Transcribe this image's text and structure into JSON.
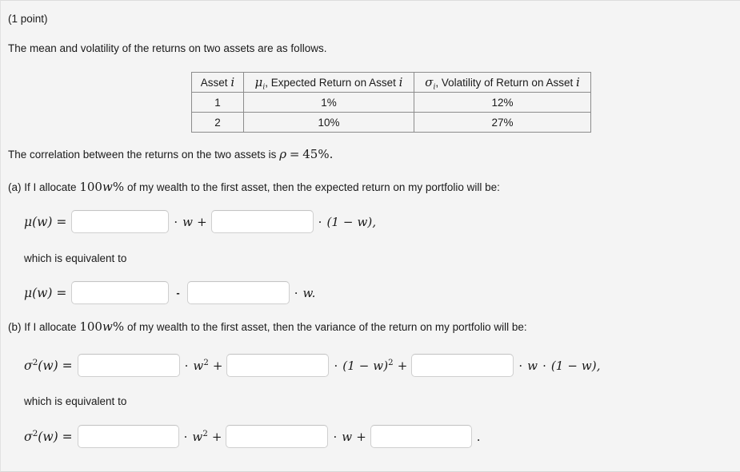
{
  "header": {
    "points": "(1 point)"
  },
  "intro": {
    "text": "The mean and volatility of the returns on two assets are as follows."
  },
  "table": {
    "headers": {
      "asset": "Asset i",
      "asset_plain": "Asset",
      "asset_sym": "i",
      "mu_sym": "μ",
      "mu_sub": "i",
      "mu_rest": ", Expected Return on Asset",
      "mu_trail": "i",
      "sigma_sym": "σ",
      "sigma_sub": "i",
      "sigma_rest": ", Volatility of Return on Asset",
      "sigma_trail": "i"
    },
    "rows": [
      {
        "asset": "1",
        "expected_return": "1%",
        "volatility": "12%"
      },
      {
        "asset": "2",
        "expected_return": "10%",
        "volatility": "27%"
      }
    ]
  },
  "correlation": {
    "prefix": "The correlation between the returns on the two assets is",
    "rho": "ρ",
    "equals": "=",
    "value": "45%",
    "period": "."
  },
  "part_a": {
    "label": "(a) If I allocate",
    "amount": "100",
    "amount_var": "w",
    "amount_pct": "%",
    "rest": "of my wealth to the first asset, then the expected return on my portfolio will be:",
    "equiv_text": "which is equivalent to",
    "formula1": {
      "lhs": "μ(w) =",
      "dot1": "·",
      "term1": "w",
      "plus": "+",
      "dot2": "·",
      "term2": "(1 − w),",
      "input1_value": "",
      "input2_value": ""
    },
    "formula2": {
      "lhs": "μ(w) =",
      "minus": "-",
      "dot1": "·",
      "term1": "w.",
      "input1_value": "",
      "input2_value": ""
    }
  },
  "part_b": {
    "label": "(b) If I allocate",
    "amount": "100",
    "amount_var": "w",
    "amount_pct": "%",
    "rest": "of my wealth to the first asset, then the variance of the return on my portfolio will be:",
    "equiv_text": "which is equivalent to",
    "formula1": {
      "lhs_sigma": "σ",
      "lhs_exp": "2",
      "lhs_arg": "(w) =",
      "dot1": "·",
      "term1_var": "w",
      "term1_exp": "2",
      "plus1": "+",
      "dot2": "·",
      "term2": "(1 − w)",
      "term2_exp": "2",
      "plus2": "+",
      "dot3": "·",
      "term3": "w",
      "dot4": "·",
      "term4": "(1 − w),",
      "input1_value": "",
      "input2_value": "",
      "input3_value": ""
    },
    "formula2": {
      "lhs_sigma": "σ",
      "lhs_exp": "2",
      "lhs_arg": "(w) =",
      "dot1": "·",
      "term1_var": "w",
      "term1_exp": "2",
      "plus1": "+",
      "dot2": "·",
      "term2": "w",
      "plus2": "+",
      "period": ".",
      "input1_value": "",
      "input2_value": "",
      "input3_value": ""
    }
  },
  "colors": {
    "background": "#f4f4f4",
    "text": "#1a1a1a",
    "input_border": "#cfcfcf",
    "input_background": "#ffffff",
    "table_border": "#8c8c8c"
  }
}
